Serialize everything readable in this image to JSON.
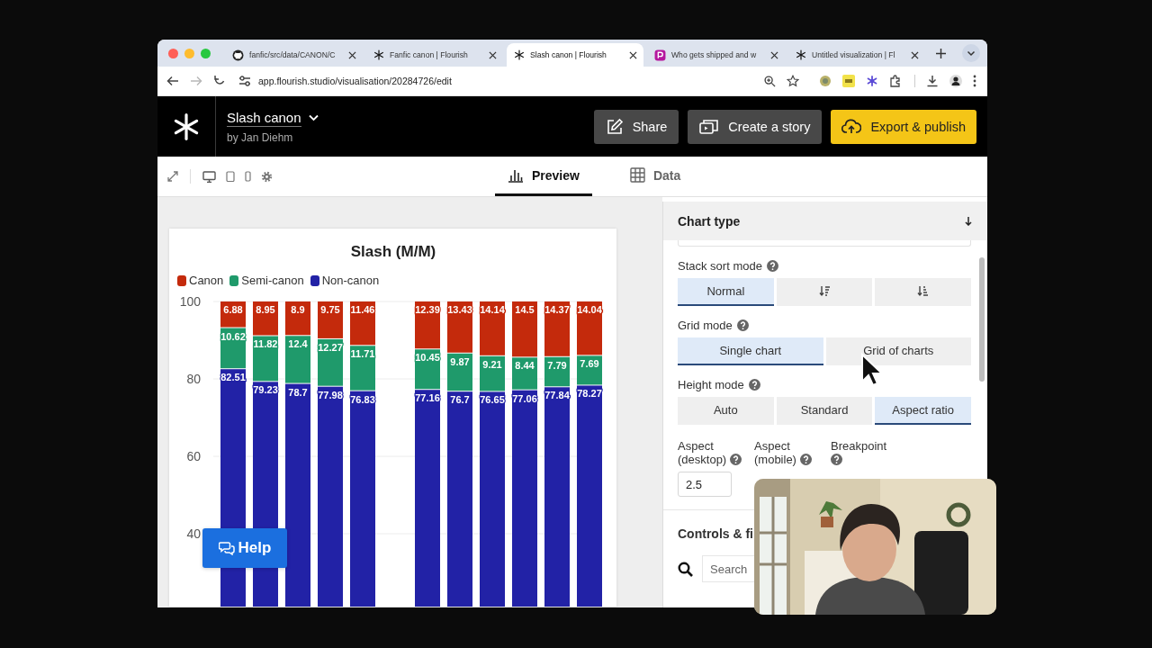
{
  "browser": {
    "tabs": [
      {
        "title": "fanfic/src/data/CANON/C",
        "kind": "github",
        "selected": false
      },
      {
        "title": "Fanfic canon | Flourish",
        "kind": "flourish",
        "selected": false
      },
      {
        "title": "Slash canon | Flourish",
        "kind": "flourish",
        "selected": true
      },
      {
        "title": "Who gets shipped and w",
        "kind": "p-logo",
        "selected": false
      },
      {
        "title": "Untitled visualization | Fl",
        "kind": "flourish",
        "selected": false
      }
    ],
    "nav": [
      {
        "kind": "back",
        "disabled": false
      },
      {
        "kind": "forward",
        "disabled": true
      },
      {
        "kind": "reload",
        "disabled": false
      }
    ],
    "url": "app.flourish.studio/visualisation/20284726/edit"
  },
  "app": {
    "project_title": "Slash canon",
    "author": "by Jan Diehm",
    "buttons": [
      {
        "label": "Share",
        "kind": "share"
      },
      {
        "label": "Create a story",
        "kind": "story"
      },
      {
        "label": "Export & publish",
        "kind": "export"
      }
    ]
  },
  "toolbar": {
    "view_tabs": [
      {
        "label": "Preview",
        "kind": "chart",
        "selected": true
      },
      {
        "label": "Data",
        "kind": "table",
        "selected": false
      }
    ]
  },
  "chart_card": {
    "chart_data": {
      "type": "bar",
      "title": "Slash (M/M)",
      "stacked": true,
      "orientation": "vertical",
      "data_labels": true,
      "grid": true,
      "legend": "top",
      "ylim": [
        0,
        100
      ],
      "yticks": [
        40,
        60,
        80,
        100
      ],
      "series": [
        {
          "name": "Non-canon",
          "color": "#2222a6",
          "values": [
            82.51,
            79.23,
            78.7,
            77.98,
            76.83,
            null,
            77.16,
            76.7,
            76.65,
            77.06,
            77.84,
            78.27
          ]
        },
        {
          "name": "Semi-canon",
          "color": "#1f9a6b",
          "values": [
            10.62,
            11.82,
            12.4,
            12.27,
            11.71,
            null,
            10.45,
            9.87,
            9.21,
            8.44,
            7.79,
            7.69
          ]
        },
        {
          "name": "Canon",
          "color": "#c42a0c",
          "values": [
            6.88,
            8.95,
            8.9,
            9.75,
            11.46,
            null,
            12.39,
            13.43,
            14.14,
            14.5,
            14.37,
            14.04
          ]
        }
      ]
    }
  },
  "help_button": {
    "label": "Help"
  },
  "settings_panel": {
    "section_title": "Chart type",
    "groups": [
      {
        "label": "Stack sort mode",
        "options": [
          {
            "label": "Normal",
            "selected": true
          },
          {
            "kind": "descending",
            "selected": false
          },
          {
            "kind": "ascending",
            "selected": false
          }
        ]
      },
      {
        "label": "Grid mode",
        "options": [
          {
            "label": "Single chart",
            "selected": true
          },
          {
            "label": "Grid of charts",
            "selected": false
          }
        ]
      },
      {
        "label": "Height mode",
        "options": [
          {
            "label": "Auto",
            "selected": false
          },
          {
            "label": "Standard",
            "selected": false
          },
          {
            "label": "Aspect ratio",
            "selected": true
          }
        ]
      }
    ],
    "aspect_fields": [
      {
        "label": "Aspect (desktop)",
        "value": "2.5"
      },
      {
        "label": "Aspect (mobile)"
      },
      {
        "label": "Breakpoint"
      }
    ],
    "next_section": "Controls & fi",
    "search": {
      "placeholder": "Search"
    }
  }
}
